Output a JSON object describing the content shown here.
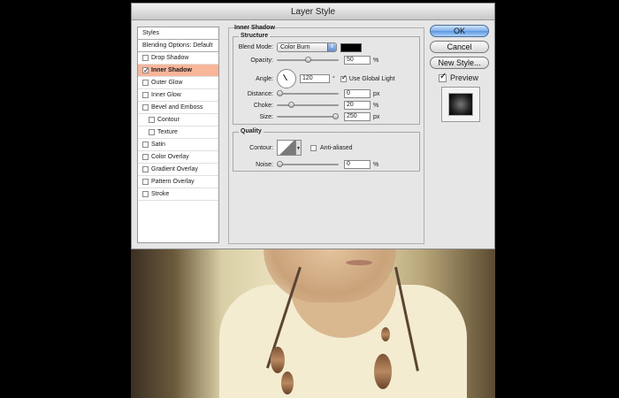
{
  "window": {
    "title": "Layer Style"
  },
  "left_panel": {
    "items": [
      {
        "label": "Styles",
        "type": "head"
      },
      {
        "label": "Blending Options: Default",
        "type": "head"
      },
      {
        "label": "Drop Shadow",
        "checked": false
      },
      {
        "label": "Inner Shadow",
        "checked": true,
        "selected": true
      },
      {
        "label": "Outer Glow",
        "checked": false
      },
      {
        "label": "Inner Glow",
        "checked": false
      },
      {
        "label": "Bevel and Emboss",
        "checked": false
      },
      {
        "label": "Contour",
        "checked": false,
        "indent": true
      },
      {
        "label": "Texture",
        "checked": false,
        "indent": true
      },
      {
        "label": "Satin",
        "checked": false
      },
      {
        "label": "Color Overlay",
        "checked": false
      },
      {
        "label": "Gradient Overlay",
        "checked": false
      },
      {
        "label": "Pattern Overlay",
        "checked": false
      },
      {
        "label": "Stroke",
        "checked": false
      }
    ]
  },
  "panel": {
    "title": "Inner Shadow",
    "structure": {
      "label": "Structure",
      "blend_mode_label": "Blend Mode:",
      "blend_mode_value": "Color Burn",
      "blend_color": "#000000",
      "opacity_label": "Opacity:",
      "opacity_value": "50",
      "opacity_unit": "%",
      "opacity_fraction": 0.5,
      "angle_label": "Angle:",
      "angle_value": "120",
      "angle_unit": "°",
      "use_global_light_label": "Use Global Light",
      "use_global_light": true,
      "distance_label": "Distance:",
      "distance_value": "0",
      "distance_unit": "px",
      "distance_fraction": 0.0,
      "choke_label": "Choke:",
      "choke_value": "20",
      "choke_unit": "%",
      "choke_fraction": 0.2,
      "size_label": "Size:",
      "size_value": "250",
      "size_unit": "px",
      "size_fraction": 1.0
    },
    "quality": {
      "label": "Quality",
      "contour_label": "Contour:",
      "anti_aliased_label": "Anti-aliased",
      "anti_aliased": false,
      "noise_label": "Noise:",
      "noise_value": "0",
      "noise_unit": "%",
      "noise_fraction": 0.0
    }
  },
  "buttons": {
    "ok": "OK",
    "cancel": "Cancel",
    "new_style": "New Style...",
    "preview_label": "Preview",
    "preview_checked": true
  },
  "icons": {
    "angle_dial": "angle-dial-icon",
    "contour_picker": "contour-curve-icon",
    "dropdown_arrow": "chevron-updown-icon"
  }
}
